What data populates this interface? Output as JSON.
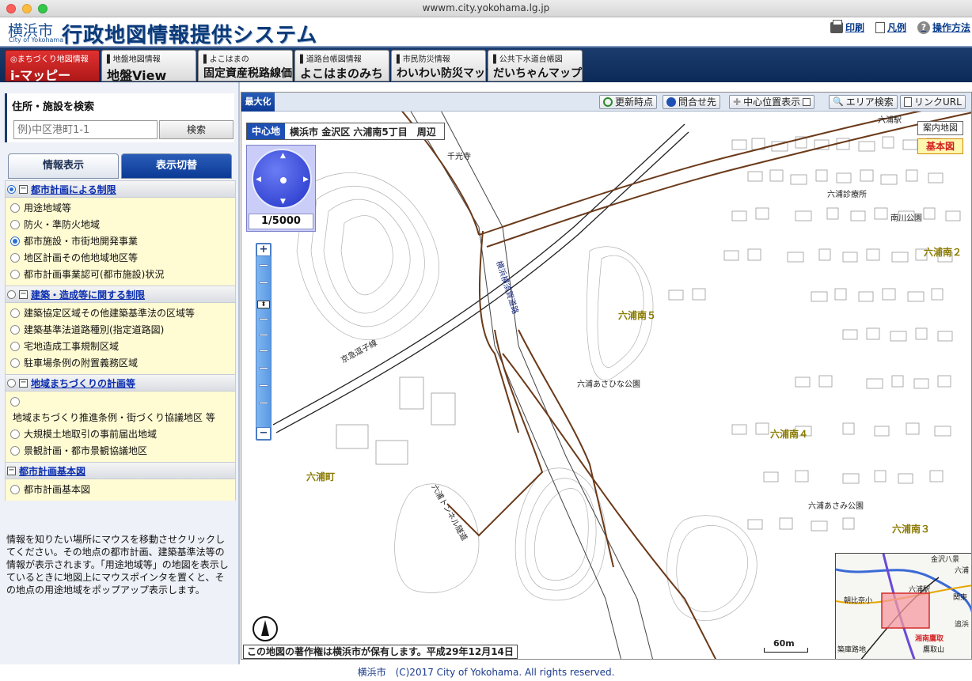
{
  "browser": {
    "url": "wwwm.city.yokohama.lg.jp"
  },
  "header": {
    "city_name": "横浜市",
    "city_name_en": "City of Yokohama",
    "title": "行政地図情報提供システム",
    "links": {
      "print": "印刷",
      "legend": "凡例",
      "help": "操作方法"
    }
  },
  "tabs": [
    {
      "sub": "◎まちづくり地図情報",
      "main": "i-マッピー",
      "active": true
    },
    {
      "sub": "▌地盤地図情報",
      "main": "地盤View",
      "active": false
    },
    {
      "sub": "▌よこはまの",
      "main": "固定資産税路線価",
      "active": false
    },
    {
      "sub": "▌道路台帳図情報",
      "main": "よこはまのみち",
      "active": false
    },
    {
      "sub": "▌市民防災情報",
      "main": "わいわい防災マップ",
      "active": false
    },
    {
      "sub": "▌公共下水道台帳図",
      "main": "だいちゃんマップ",
      "active": false
    }
  ],
  "search": {
    "title": "住所・施設を検索",
    "placeholder": "例)中区港町1-1",
    "button": "検索"
  },
  "panel_tabs": {
    "info": "情報表示",
    "display": "表示切替"
  },
  "sections": [
    {
      "title": "都市計画による制限",
      "selected": true,
      "options": [
        "用途地域等",
        "防火・準防火地域",
        "都市施設・市街地開発事業",
        "地区計画その他地域地区等",
        "都市計画事業認可(都市施設)状況"
      ],
      "checked_index": 2
    },
    {
      "title": "建築・造成等に関する制限",
      "selected": false,
      "options": [
        "建築協定区域その他建築基準法の区域等",
        "建築基準法道路種別(指定道路図)",
        "宅地造成工事規制区域",
        "駐車場条例の附置義務区域"
      ]
    },
    {
      "title": "地域まちづくりの計画等",
      "selected": false,
      "options_note": "地域まちづくり推進条例・街づくり協議地区 等",
      "options": [
        "大規模土地取引の事前届出地域",
        "景観計画・都市景観協議地区"
      ]
    },
    {
      "title": "都市計画基本図",
      "selected": false,
      "options": [
        "都市計画基本図"
      ]
    }
  ],
  "help_text": "情報を知りたい場所にマウスを移動させクリックしてください。その地点の都市計画、建築基準法等の情報が表示されます。「用途地域等」の地図を表示しているときに地図上にマウスポインタを置くと、その地点の用途地域をポップアップ表示します。",
  "map": {
    "maximize": "最大化",
    "toolbar": {
      "update": "更新時点",
      "inquiry": "問合せ先",
      "center_display": "中心位置表示",
      "area_search": "エリア検索",
      "link_url": "リンクURL"
    },
    "center_label": "中心地",
    "center_address": "横浜市 金沢区 六浦南5丁目　周辺",
    "guide_map": "案内地図",
    "basic_map": "基本図",
    "scale": "1/5000",
    "scale_bar": "60m",
    "copyright": "この地図の著作権は横浜市が保有します。平成29年12月14日",
    "labels": [
      "六浦南５",
      "六浦南４",
      "六浦南３",
      "六浦南２",
      "六浦町",
      "六浦駅",
      "六浦診療所",
      "南川公園",
      "六浦あさひな公園",
      "六浦あさみ公園",
      "京急逗子線",
      "横浜横須賀道路",
      "六浦トンネル隧道",
      "千光寺"
    ],
    "overview_labels": [
      "金沢八景",
      "六浦",
      "六浦駅",
      "朝比奈小",
      "関東",
      "追浜",
      "湘南鷹取",
      "鷹取山",
      "築庫路地"
    ]
  },
  "colors": {
    "brand_navy": "#0b3a78",
    "active_tab": "#c41f1f",
    "road_brown": "#6b3a1a",
    "label_yellow": "#8a7a00"
  },
  "footer": "横浜市　(C)2017 City of Yokohama. All rights reserved."
}
